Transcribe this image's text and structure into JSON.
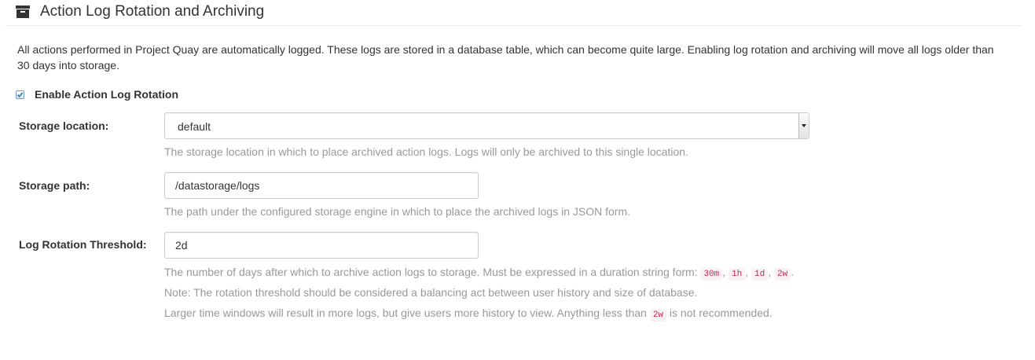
{
  "section": {
    "title": "Action Log Rotation and Archiving",
    "icon": "archive-icon",
    "description": "All actions performed in Project Quay are automatically logged. These logs are stored in a database table, which can become quite large. Enabling log rotation and archiving will move all logs older than 30 days into storage."
  },
  "enable": {
    "label": "Enable Action Log Rotation",
    "checked": true
  },
  "storage_location": {
    "label": "Storage location:",
    "value": "default",
    "help": "The storage location in which to place archived action logs. Logs will only be archived to this single location."
  },
  "storage_path": {
    "label": "Storage path:",
    "value": "/datastorage/logs",
    "help": "The path under the configured storage engine in which to place the archived logs in JSON form."
  },
  "threshold": {
    "label": "Log Rotation Threshold:",
    "value": "2d",
    "help_prefix": "The number of days after which to archive action logs to storage. Must be expressed in a duration string form: ",
    "examples": [
      "30m",
      "1h",
      "1d",
      "2w"
    ],
    "note": "Note: The rotation threshold should be considered a balancing act between user history and size of database.",
    "warning_prefix": "Larger time windows will result in more logs, but give users more history to view. Anything less than ",
    "warning_code": "2w",
    "warning_suffix": " is not recommended."
  },
  "colors": {
    "help_text": "#999999",
    "code_text": "#c7254e",
    "code_bg": "#f9f2f4",
    "checkbox_border": "#6f9bd1"
  }
}
